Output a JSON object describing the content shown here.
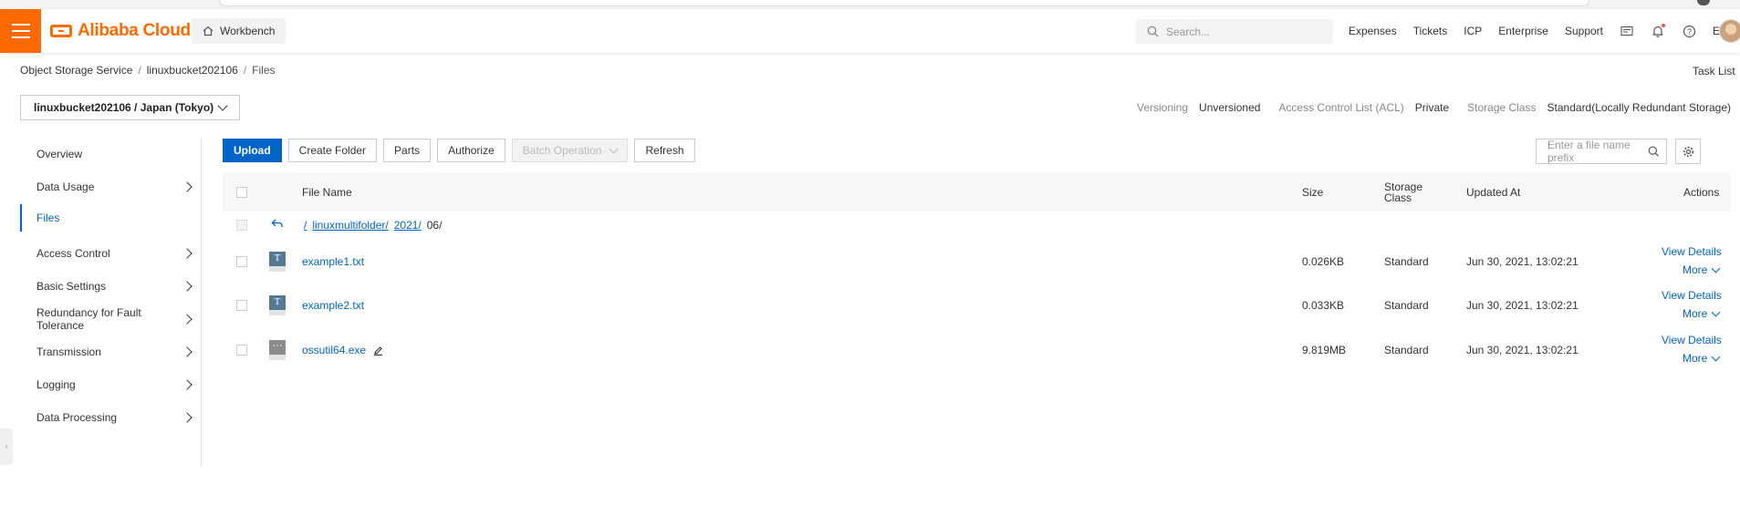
{
  "header": {
    "brand": "Alibaba Cloud",
    "workbench": "Workbench",
    "search_placeholder": "Search...",
    "links": [
      "Expenses",
      "Tickets",
      "ICP",
      "Enterprise",
      "Support"
    ],
    "language": "EN",
    "icons": [
      "mail-icon",
      "bell-icon",
      "help-icon"
    ]
  },
  "breadcrumb": {
    "root": "Object Storage Service",
    "bucket": "linuxbucket202106",
    "current": "Files"
  },
  "task_list": "Task List",
  "bucket_selector": "linuxbucket202106 / Japan (Tokyo)",
  "bucket_meta": {
    "versioning_label": "Versioning",
    "versioning_value": "Unversioned",
    "acl_label": "Access Control List (ACL)",
    "acl_value": "Private",
    "storage_class_label": "Storage Class",
    "storage_class_value": "Standard(Locally Redundant Storage)"
  },
  "sidebar": {
    "items": [
      {
        "label": "Overview",
        "expandable": false
      },
      {
        "label": "Data Usage",
        "expandable": true
      },
      {
        "label": "Files",
        "expandable": false,
        "active": true
      },
      {
        "label": "Access Control",
        "expandable": true
      },
      {
        "label": "Basic Settings",
        "expandable": true
      },
      {
        "label": "Redundancy for Fault Tolerance",
        "expandable": true
      },
      {
        "label": "Transmission",
        "expandable": true
      },
      {
        "label": "Logging",
        "expandable": true
      },
      {
        "label": "Data Processing",
        "expandable": true
      }
    ]
  },
  "toolbar": {
    "upload": "Upload",
    "create_folder": "Create Folder",
    "parts": "Parts",
    "authorize": "Authorize",
    "batch_operation": "Batch Operation",
    "refresh": "Refresh",
    "prefix_placeholder": "Enter a file name prefix"
  },
  "table": {
    "headers": {
      "file_name": "File Name",
      "size": "Size",
      "storage_class_line1": "Storage",
      "storage_class_line2": "Class",
      "updated_at": "Updated At",
      "actions": "Actions"
    },
    "path": {
      "root": "/",
      "folder1": "linuxmultifolder/",
      "folder2": "2021/",
      "current": "06/"
    },
    "rows": [
      {
        "name": "example1.txt",
        "type": "txt",
        "size": "0.026KB",
        "storage_class": "Standard",
        "updated": "Jun 30, 2021, 13:02:21",
        "view": "View Details",
        "more": "More"
      },
      {
        "name": "example2.txt",
        "type": "txt",
        "size": "0.033KB",
        "storage_class": "Standard",
        "updated": "Jun 30, 2021, 13:02:21",
        "view": "View Details",
        "more": "More"
      },
      {
        "name": "ossutil64.exe",
        "type": "exe",
        "size": "9.819MB",
        "storage_class": "Standard",
        "updated": "Jun 30, 2021, 13:02:21",
        "view": "View Details",
        "more": "More"
      }
    ]
  },
  "colors": {
    "brand_orange": "#ff6a00",
    "primary_blue": "#0064c8"
  }
}
